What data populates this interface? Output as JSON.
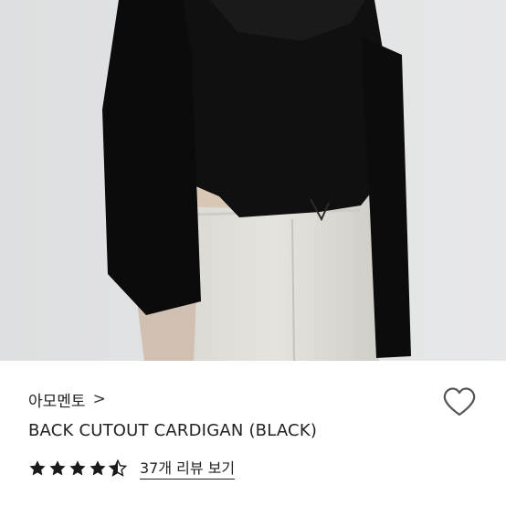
{
  "product": {
    "brand": "아모멘토",
    "brand_chevron": ">",
    "title": "BACK CUTOUT CARDIGAN (BLACK)",
    "rating": 4.5,
    "rating_max": 5,
    "review_link": "37개 리뷰 보기"
  },
  "icons": {
    "brand_chevron": "chevron-right-icon",
    "wishlist": "heart-outline-icon",
    "star": "star-icon"
  },
  "colors": {
    "text": "#222222",
    "star": "#1a1a1a",
    "heart": "#555555"
  }
}
